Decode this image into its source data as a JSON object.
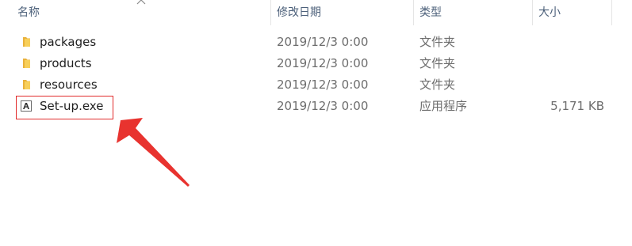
{
  "columns": {
    "name": "名称",
    "modified": "修改日期",
    "type": "类型",
    "size": "大小"
  },
  "files": [
    {
      "name": "packages",
      "modified": "2019/12/3 0:00",
      "type": "文件夹",
      "size": "",
      "icon": "folder-icon"
    },
    {
      "name": "products",
      "modified": "2019/12/3 0:00",
      "type": "文件夹",
      "size": "",
      "icon": "folder-icon"
    },
    {
      "name": "resources",
      "modified": "2019/12/3 0:00",
      "type": "文件夹",
      "size": "",
      "icon": "folder-icon"
    },
    {
      "name": "Set-up.exe",
      "modified": "2019/12/3 0:00",
      "type": "应用程序",
      "size": "5,171 KB",
      "icon": "adobe-exe-icon"
    }
  ],
  "annotation": {
    "highlighted_item": "Set-up.exe",
    "color": "#e12b2b"
  },
  "colors": {
    "header_text": "#4c607a",
    "folder": "#f3c046",
    "highlight": "#e12b2b"
  }
}
